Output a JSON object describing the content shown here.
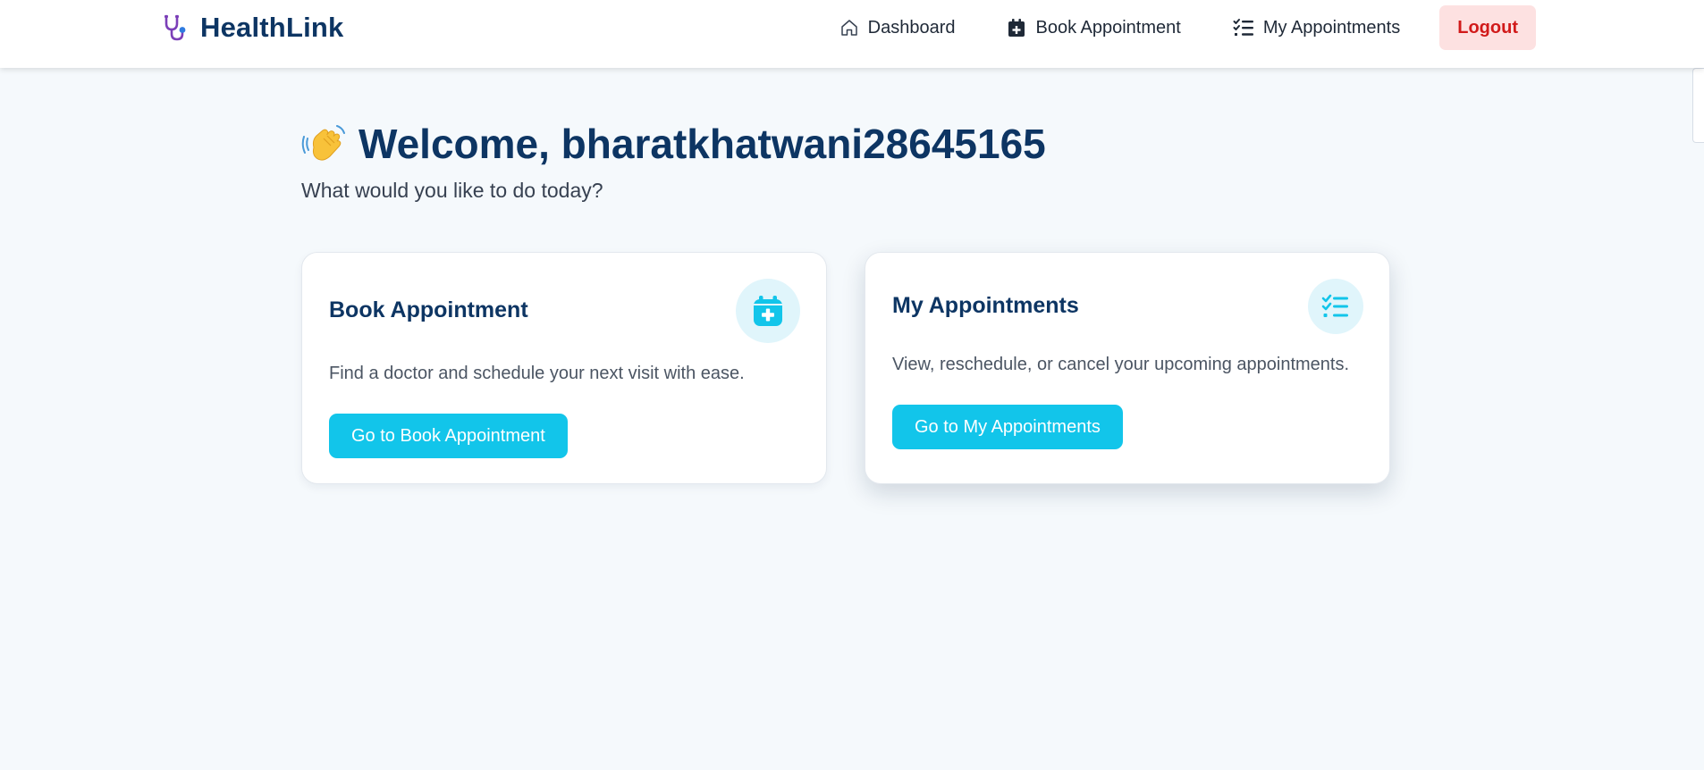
{
  "app": {
    "name": "HealthLink",
    "logo_icon": "stethoscope-icon"
  },
  "nav": {
    "items": [
      {
        "label": "Dashboard",
        "icon": "home-icon"
      },
      {
        "label": "Book Appointment",
        "icon": "calendar-plus-icon"
      },
      {
        "label": "My Appointments",
        "icon": "checklist-icon"
      }
    ],
    "logout_label": "Logout"
  },
  "welcome": {
    "emoji_icon": "waving-hand-icon",
    "greeting": "Welcome, bharatkhatwani28645165",
    "subtitle": "What would you like to do today?"
  },
  "cards": [
    {
      "title": "Book Appointment",
      "icon": "calendar-plus-icon",
      "description": "Find a doctor and schedule your next visit with ease.",
      "button_label": "Go to Book Appointment"
    },
    {
      "title": "My Appointments",
      "icon": "checklist-icon",
      "description": "View, reschedule, or cancel your upcoming appointments.",
      "button_label": "Go to My Appointments"
    }
  ],
  "colors": {
    "brand_navy": "#0d3563",
    "accent_cyan": "#12c5ea",
    "icon_bg": "#e0f5fb",
    "logout_bg": "#fde1e1",
    "logout_text": "#d11a1a",
    "page_bg": "#f5f9fc"
  }
}
